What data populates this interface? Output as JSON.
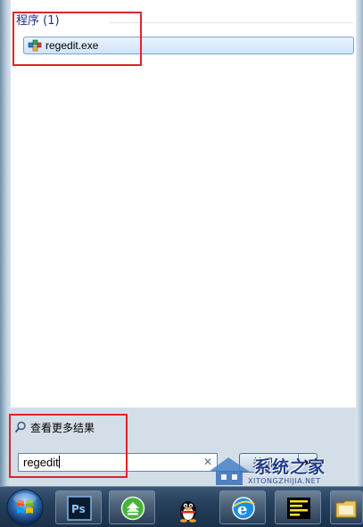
{
  "results": {
    "group_header": "程序 (1)",
    "items": [
      {
        "label": "regedit.exe",
        "icon": "registry-editor-icon"
      }
    ]
  },
  "bottom": {
    "see_more_label": "查看更多结果",
    "search_value": "regedit",
    "clear_glyph": "✕",
    "shutdown_label": "关机",
    "shutdown_arrow": "▶"
  },
  "watermark": {
    "cn": "系统之家",
    "en": "XITONGZHIJIA.NET"
  },
  "taskbar": {
    "pinned": [
      "photoshop-icon",
      "update-icon",
      "qq-icon",
      "internet-explorer-icon",
      "notepad-icon",
      "file-explorer-icon"
    ]
  },
  "colors": {
    "annotation": "#e0232d",
    "header_text": "#1e3287",
    "selection": "#cfe3fb"
  }
}
